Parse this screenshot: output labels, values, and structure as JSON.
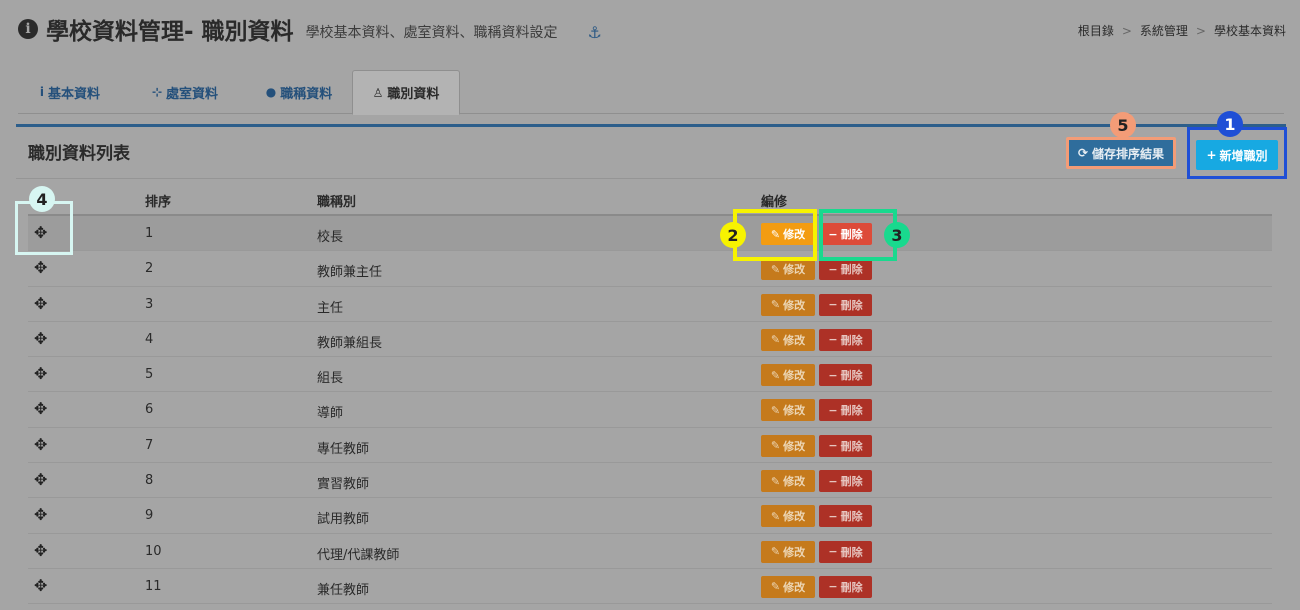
{
  "header": {
    "title": "學校資料管理- 職別資料",
    "subtitle": "學校基本資料、處室資料、職稱資料設定",
    "info_icon": "i",
    "anchor_icon": "⚓"
  },
  "breadcrumb": [
    "根目錄",
    "系統管理",
    "學校基本資料"
  ],
  "tabs": [
    {
      "label": "基本資料",
      "icon": "i"
    },
    {
      "label": "處室資料",
      "icon": "⊹"
    },
    {
      "label": "職稱資料",
      "icon": "●"
    },
    {
      "label": "職別資料",
      "icon": "♙"
    }
  ],
  "panel": {
    "title": "職別資料列表",
    "save_label": "儲存排序結果",
    "add_label": "新增職別"
  },
  "table": {
    "headers": [
      "",
      "排序",
      "職稱別",
      "編修"
    ],
    "edit_label": "修改",
    "delete_label": "刪除",
    "rows": [
      {
        "order": "1",
        "name": "校長"
      },
      {
        "order": "2",
        "name": "教師兼主任"
      },
      {
        "order": "3",
        "name": "主任"
      },
      {
        "order": "4",
        "name": "教師兼組長"
      },
      {
        "order": "5",
        "name": "組長"
      },
      {
        "order": "6",
        "name": "導師"
      },
      {
        "order": "7",
        "name": "專任教師"
      },
      {
        "order": "8",
        "name": "實習教師"
      },
      {
        "order": "9",
        "name": "試用教師"
      },
      {
        "order": "10",
        "name": "代理/代課教師"
      },
      {
        "order": "11",
        "name": "兼任教師"
      }
    ]
  },
  "callouts": [
    "1",
    "2",
    "3",
    "4",
    "5"
  ],
  "colors": {
    "callout_1": "#1f4fd6",
    "callout_2": "#f7f300",
    "callout_3": "#19d98e",
    "callout_4": "#d7f6f2",
    "callout_5": "#f39c77"
  }
}
